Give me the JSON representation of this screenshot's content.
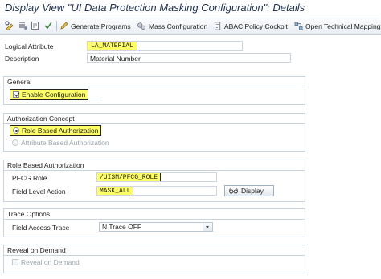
{
  "window": {
    "title": "Display View \"UI Data Protection Masking Configuration\": Details"
  },
  "toolbar": {
    "generate_programs": "Generate Programs",
    "mass_configuration": "Mass Configuration",
    "abac_policy_cockpit": "ABAC Policy Cockpit",
    "open_technical_mapping": "Open Technical Mapping"
  },
  "header": {
    "logical_attribute_label": "Logical Attribute",
    "logical_attribute_value": "LA_MATERIAL",
    "description_label": "Description",
    "description_value": "Material Number"
  },
  "general": {
    "title": "General",
    "enable_configuration_label": "Enable Configuration",
    "enable_configuration_checked": true
  },
  "authorization_concept": {
    "title": "Authorization Concept",
    "role_based_label": "Role Based Authorization",
    "attribute_based_label": "Attribute Based Authorization",
    "selected": "role_based"
  },
  "role_based_authorization": {
    "title": "Role Based Authorization",
    "pfcg_role_label": "PFCG Role",
    "pfcg_role_value": "/UISM/PFCG_ROLE",
    "field_level_action_label": "Field Level Action",
    "field_level_action_value": "MASK_ALL",
    "display_button": "Display"
  },
  "trace_options": {
    "title": "Trace Options",
    "field_access_trace_label": "Field Access Trace",
    "field_access_trace_value": "N Trace OFF"
  },
  "reveal_on_demand": {
    "title": "Reveal on Demand",
    "reveal_label": "Reveal on Demand",
    "reveal_checked": false
  },
  "colors": {
    "highlight": "#ffff66",
    "title_text": "#1e3050",
    "frame_border": "#c9d3de"
  }
}
